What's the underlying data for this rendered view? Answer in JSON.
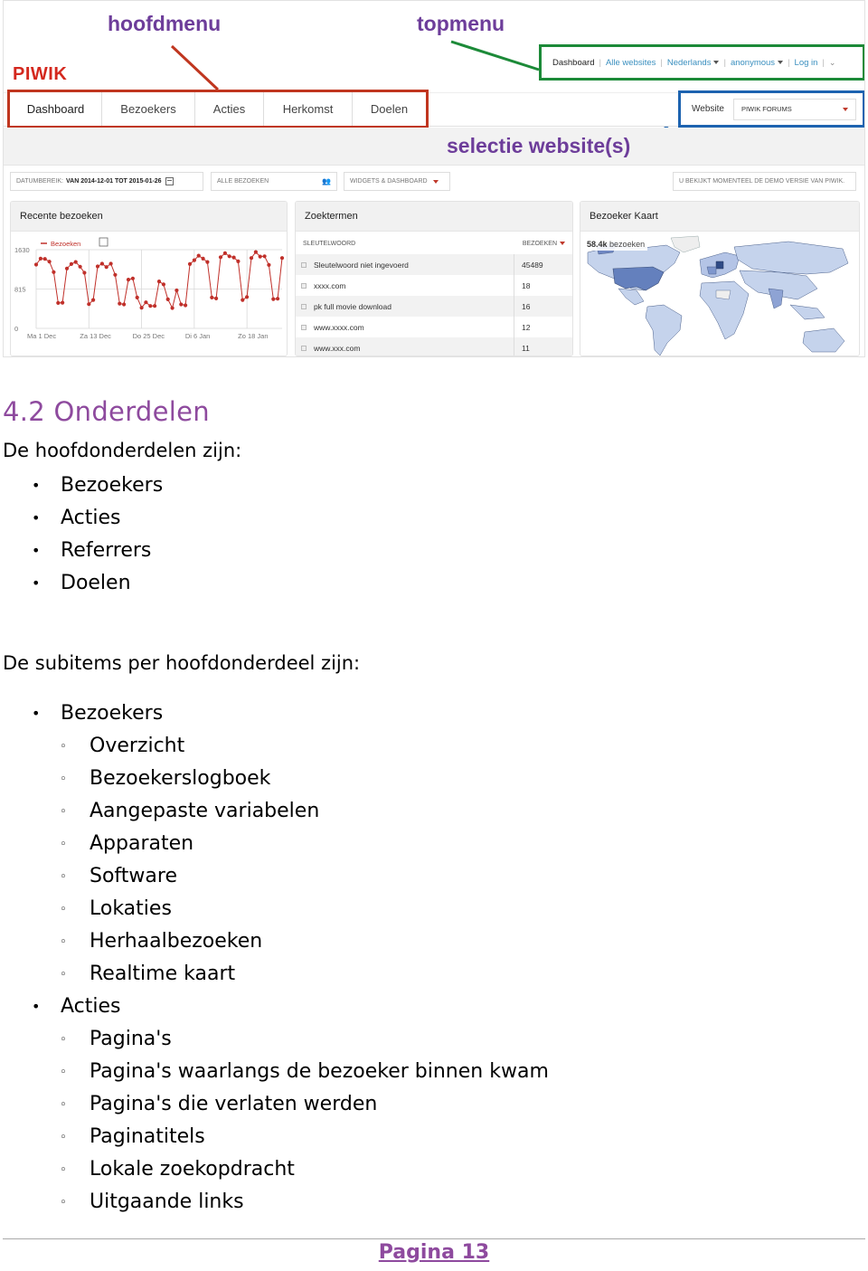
{
  "annotations": {
    "hoofdmenu": "hoofdmenu",
    "topmenu": "topmenu",
    "selectie": "selectie website(s)",
    "colors": {
      "hoofdmenu": "#c0361f",
      "topmenu": "#1c8a38",
      "selectie": "#1d63b0",
      "label": "#6d3d9a"
    }
  },
  "app": {
    "logo": "PIWIK",
    "main_menu": [
      "Dashboard",
      "Bezoekers",
      "Acties",
      "Herkomst",
      "Doelen"
    ],
    "top_menu": [
      {
        "label": "Dashboard",
        "active": true
      },
      {
        "label": "Alle websites"
      },
      {
        "label": "Nederlands",
        "dropdown": true
      },
      {
        "label": "anonymous",
        "dropdown": true
      },
      {
        "label": "Log in"
      }
    ],
    "website_label": "Website",
    "website_selected": "PIWIK FORUMS",
    "filters": {
      "date_label": "DATUMBEREIK:",
      "date_value": "VAN 2014-12-01 TOT 2015-01-26",
      "segment": "ALLE BEZOEKEN",
      "widgets": "WIDGETS & DASHBOARD",
      "demo_notice": "U BEKIJKT MOMENTEEL DE DEMO VERSIE VAN PIWIK."
    },
    "widgets": {
      "visits_title": "Recente bezoeken",
      "keywords_title": "Zoektermen",
      "map_title": "Bezoeker Kaart",
      "keywords_col1": "SLEUTELWOORD",
      "keywords_col2": "BEZOEKEN",
      "keywords": [
        {
          "keyword": "Sleutelwoord niet ingevoerd",
          "visits": "45489"
        },
        {
          "keyword": "xxxx.com",
          "visits": "18"
        },
        {
          "keyword": "pk full movie download",
          "visits": "16"
        },
        {
          "keyword": "www.xxxx.com",
          "visits": "12"
        },
        {
          "keyword": "www.xxx.com",
          "visits": "11"
        }
      ],
      "map_total": "58.4k",
      "map_unit": "bezoeken"
    }
  },
  "chart_data": {
    "type": "line",
    "title": "Recente bezoeken",
    "legend": [
      "Bezoeken"
    ],
    "legend_position": "top-left",
    "color": "#c0302a",
    "ylim": [
      0,
      1630
    ],
    "yticks": [
      "0",
      "815",
      "1630"
    ],
    "xticks": [
      "Ma 1 Dec",
      "Za 13 Dec",
      "Do 25 Dec",
      "Di 6 Jan",
      "Zo 18 Jan"
    ],
    "xtick_index": [
      0,
      12,
      24,
      36,
      48
    ],
    "grid": true,
    "x_start": "2014-12-01",
    "x_end": "2015-01-26",
    "series": [
      {
        "name": "Bezoeken",
        "values": [
          1320,
          1444,
          1438,
          1382,
          1165,
          527,
          533,
          1240,
          1333,
          1376,
          1277,
          1153,
          502,
          589,
          1283,
          1339,
          1271,
          1339,
          1109,
          514,
          496,
          1010,
          1035,
          638,
          428,
          539,
          465,
          465,
          973,
          911,
          601,
          421,
          787,
          496,
          477,
          1333,
          1413,
          1506,
          1444,
          1376,
          638,
          620,
          1475,
          1556,
          1494,
          1469,
          1388,
          589,
          651,
          1457,
          1581,
          1487,
          1494,
          1314,
          607,
          614,
          1457
        ]
      }
    ]
  },
  "doc": {
    "section_title": "4.2 Onderdelen",
    "intro1": "De hoofdonderdelen zijn:",
    "main_parts": [
      "Bezoekers",
      "Acties",
      "Referrers",
      "Doelen"
    ],
    "intro2": "De subitems per hoofdonderdeel zijn:",
    "groups": [
      {
        "label": "Bezoekers",
        "items": [
          "Overzicht",
          "Bezoekerslogboek",
          "Aangepaste variabelen",
          "Apparaten",
          "Software",
          "Lokaties",
          "Herhaalbezoeken",
          "Realtime kaart"
        ]
      },
      {
        "label": "Acties",
        "items": [
          "Pagina's",
          "Pagina's waarlangs de bezoeker binnen kwam",
          "Pagina's die verlaten werden",
          "Paginatitels",
          "Lokale zoekopdracht",
          "Uitgaande links"
        ]
      }
    ],
    "page_label": "Pagina 13"
  }
}
